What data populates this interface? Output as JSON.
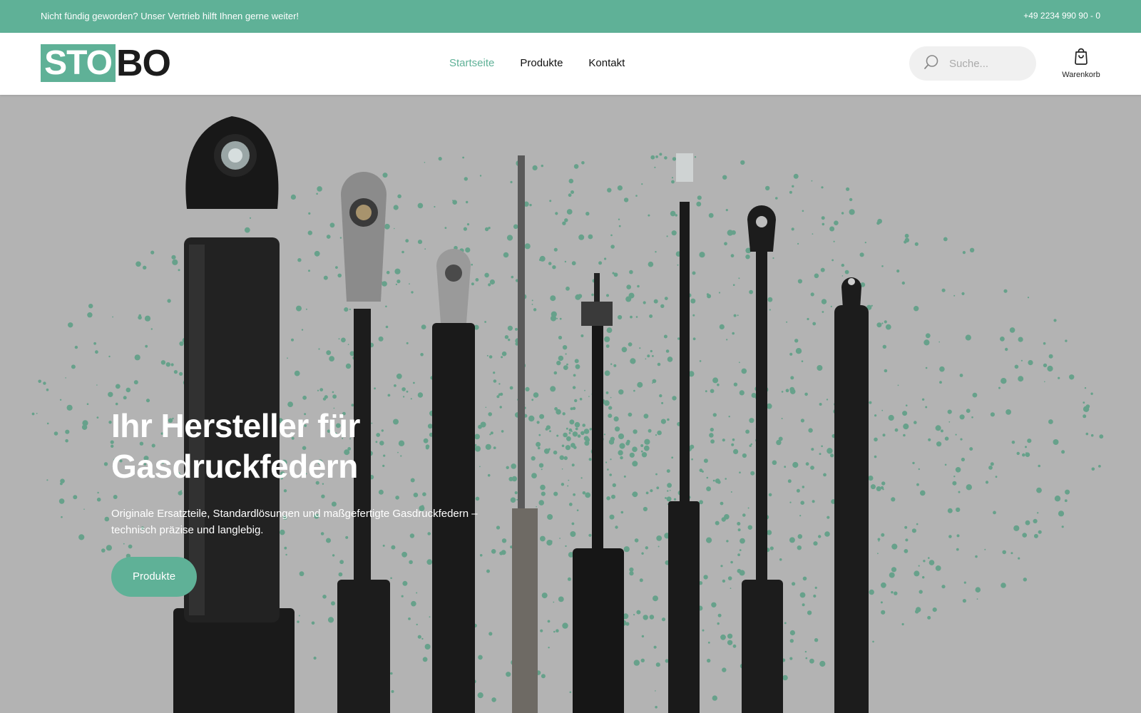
{
  "topbar": {
    "message": "Nicht fündig geworden? Unser Vertrieb hilft Ihnen gerne weiter!",
    "phone": "+49 2234 990 90 - 0"
  },
  "header": {
    "logo_accent": "STO",
    "logo_rest": "BO",
    "nav": [
      {
        "label": "Startseite",
        "active": true
      },
      {
        "label": "Produkte",
        "active": false
      },
      {
        "label": "Kontakt",
        "active": false
      }
    ],
    "search_placeholder": "Suche...",
    "cart_label": "Warenkorb"
  },
  "hero": {
    "title_line1": "Ihr Hersteller für",
    "title_line2": "Gasdruckfedern",
    "subtitle": "Originale Ersatzteile, Standardlösungen und maßgefertigte Gasdruckfedern – technisch präzise und langlebig.",
    "button_label": "Produkte"
  },
  "colors": {
    "accent": "#5fb197",
    "hero_bg": "#b3b3b3",
    "dark": "#1c1c1c"
  },
  "icons": {
    "search": "search-icon",
    "cart": "shopping-bag-icon"
  }
}
